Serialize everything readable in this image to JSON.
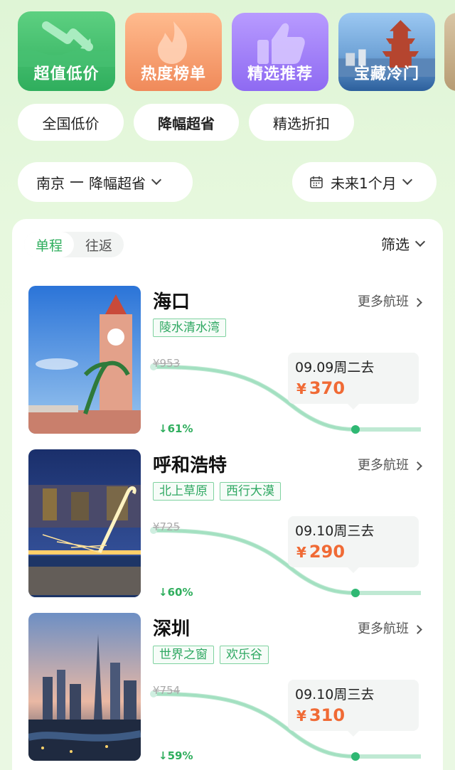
{
  "categories": [
    {
      "label": "超值低价",
      "icon": "arrow-down-trend-icon"
    },
    {
      "label": "热度榜单",
      "icon": "flame-icon"
    },
    {
      "label": "精选推荐",
      "icon": "thumbs-up-icon"
    },
    {
      "label": "宝藏冷门",
      "icon": "pagoda-photo"
    }
  ],
  "chips": [
    {
      "label": "全国低价",
      "active": false
    },
    {
      "label": "降幅超省",
      "active": true
    },
    {
      "label": "精选折扣",
      "active": false
    }
  ],
  "selectors": {
    "route_from": "南京",
    "route_mode": "降幅超省",
    "date_range": "未来1个月"
  },
  "trip_type": {
    "oneway": "单程",
    "roundtrip": "往返"
  },
  "filter_label": "筛选",
  "more_label": "更多航班",
  "colors": {
    "accent": "#2fae5d",
    "price": "#f06a35",
    "curve": "#8fdcb8"
  },
  "items": [
    {
      "city": "海口",
      "tags": [
        "陵水清水湾"
      ],
      "original_price": "¥953",
      "drop": "61%",
      "date": "09.09周二去",
      "currency": "¥",
      "price": "370"
    },
    {
      "city": "呼和浩特",
      "tags": [
        "北上草原",
        "西行大漠"
      ],
      "original_price": "¥725",
      "drop": "60%",
      "date": "09.10周三去",
      "currency": "¥",
      "price": "290"
    },
    {
      "city": "深圳",
      "tags": [
        "世界之窗",
        "欢乐谷"
      ],
      "original_price": "¥754",
      "drop": "59%",
      "date": "09.10周三去",
      "currency": "¥",
      "price": "310"
    }
  ]
}
